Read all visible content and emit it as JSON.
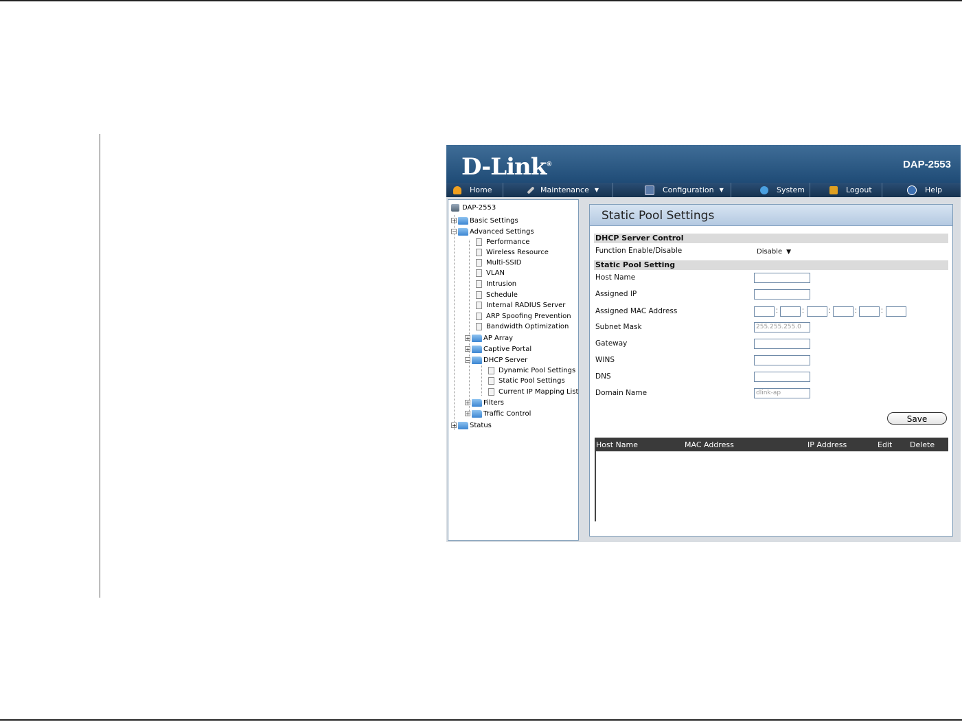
{
  "brand": {
    "logo": "D-Link",
    "registered": "®",
    "model": "DAP-2553"
  },
  "menu": [
    {
      "label": "Home",
      "icon": "home-icon",
      "dropdown": false
    },
    {
      "label": "Maintenance",
      "icon": "tools-icon",
      "dropdown": true
    },
    {
      "label": "Configuration",
      "icon": "floppy-disk-icon",
      "dropdown": true
    },
    {
      "label": "System",
      "icon": "system-icon",
      "dropdown": false
    },
    {
      "label": "Logout",
      "icon": "logout-icon",
      "dropdown": false
    },
    {
      "label": "Help",
      "icon": "help-icon",
      "dropdown": false
    }
  ],
  "tree": {
    "root": "DAP-2553",
    "basic": "Basic Settings",
    "advanced": "Advanced Settings",
    "advanced_items": [
      "Performance",
      "Wireless Resource",
      "Multi-SSID",
      "VLAN",
      "Intrusion",
      "Schedule",
      "Internal RADIUS Server",
      "ARP Spoofing Prevention",
      "Bandwidth Optimization"
    ],
    "ap_array": "AP Array",
    "captive_portal": "Captive Portal",
    "dhcp_server": "DHCP Server",
    "dhcp_items": [
      "Dynamic Pool Settings",
      "Static Pool Settings",
      "Current IP Mapping List"
    ],
    "filters": "Filters",
    "traffic_control": "Traffic Control",
    "status": "Status"
  },
  "page": {
    "title": "Static Pool Settings",
    "section_control": "DHCP Server Control",
    "function_label": "Function Enable/Disable",
    "function_value": "Disable",
    "section_pool": "Static Pool Setting",
    "host_name_label": "Host Name",
    "host_name_value": "",
    "assigned_ip_label": "Assigned IP",
    "assigned_ip_value": "",
    "mac_label": "Assigned MAC Address",
    "mac_separator": ":",
    "subnet_label": "Subnet Mask",
    "subnet_placeholder": "255.255.255.0",
    "gateway_label": "Gateway",
    "wins_label": "WINS",
    "dns_label": "DNS",
    "domain_label": "Domain Name",
    "domain_placeholder": "dlink-ap",
    "save_label": "Save"
  },
  "table": {
    "columns": [
      "Host Name",
      "MAC Address",
      "IP Address",
      "Edit",
      "Delete"
    ],
    "rows": []
  }
}
